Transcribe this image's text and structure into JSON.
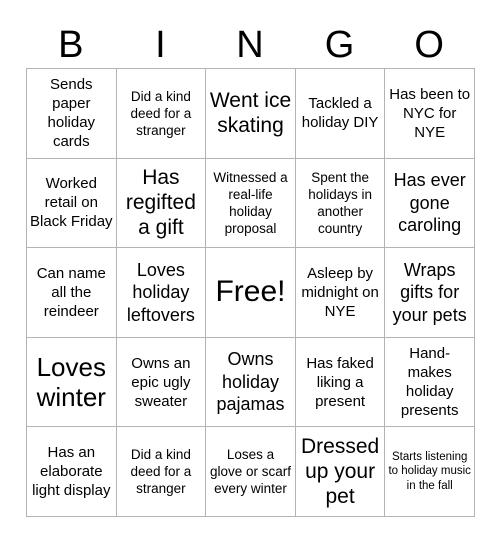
{
  "card": {
    "title": "BINGO",
    "header_letters": [
      "B",
      "I",
      "N",
      "G",
      "O"
    ],
    "border_color": "#b3b3b3",
    "text_color": "#000000",
    "background_color": "#ffffff",
    "rows": 5,
    "columns": 5,
    "cells": [
      {
        "text": "Sends paper holiday cards",
        "size": "fs-md",
        "free": false
      },
      {
        "text": "Did a kind deed for a stranger",
        "size": "fs-sm",
        "free": false
      },
      {
        "text": "Went ice skating",
        "size": "fs-xl",
        "free": false
      },
      {
        "text": "Tackled a holiday DIY",
        "size": "fs-md",
        "free": false
      },
      {
        "text": "Has been to NYC for NYE",
        "size": "fs-md",
        "free": false
      },
      {
        "text": "Worked retail on Black Friday",
        "size": "fs-md",
        "free": false
      },
      {
        "text": "Has regifted a gift",
        "size": "fs-xl",
        "free": false
      },
      {
        "text": "Witnessed a real-life holiday proposal",
        "size": "fs-sm",
        "free": false
      },
      {
        "text": "Spent the holidays in another country",
        "size": "fs-sm",
        "free": false
      },
      {
        "text": "Has ever gone caroling",
        "size": "fs-lg",
        "free": false
      },
      {
        "text": "Can name all the reindeer",
        "size": "fs-md",
        "free": false
      },
      {
        "text": "Loves holiday leftovers",
        "size": "fs-lg",
        "free": false
      },
      {
        "text": "Free!",
        "size": "fs-free",
        "free": true
      },
      {
        "text": "Asleep by midnight on NYE",
        "size": "fs-md",
        "free": false
      },
      {
        "text": "Wraps gifts for your pets",
        "size": "fs-lg",
        "free": false
      },
      {
        "text": "Loves winter",
        "size": "fs-xxl",
        "free": false
      },
      {
        "text": "Owns an epic ugly sweater",
        "size": "fs-md",
        "free": false
      },
      {
        "text": "Owns holiday pajamas",
        "size": "fs-lg",
        "free": false
      },
      {
        "text": "Has faked liking a present",
        "size": "fs-md",
        "free": false
      },
      {
        "text": "Hand-makes holiday presents",
        "size": "fs-md",
        "free": false
      },
      {
        "text": "Has an elaborate light display",
        "size": "fs-md",
        "free": false
      },
      {
        "text": "Did a kind deed for a stranger",
        "size": "fs-sm",
        "free": false
      },
      {
        "text": "Loses a glove or scarf every winter",
        "size": "fs-sm",
        "free": false
      },
      {
        "text": "Dressed up your pet",
        "size": "fs-xl",
        "free": false
      },
      {
        "text": "Starts listening to holiday music in the fall",
        "size": "fs-xs",
        "free": false
      }
    ]
  }
}
